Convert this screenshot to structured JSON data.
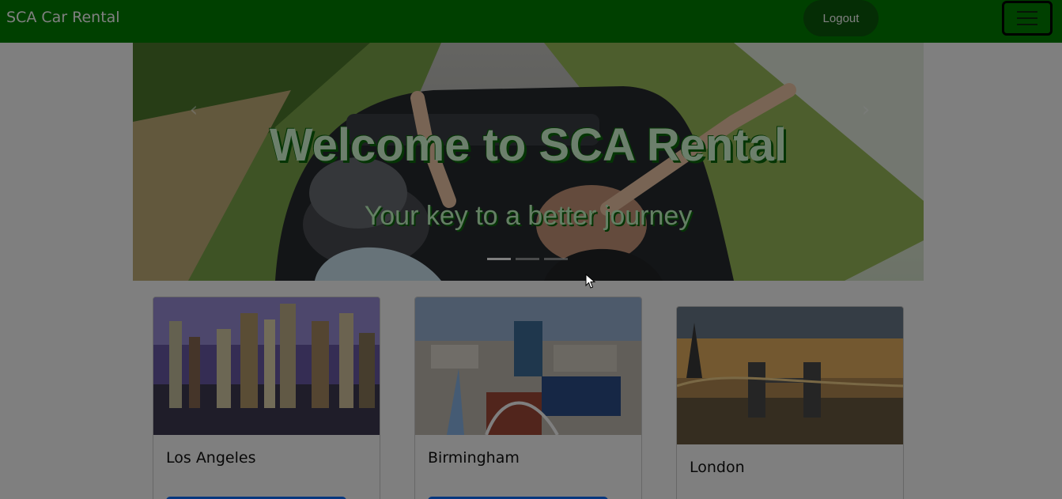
{
  "navbar": {
    "brand": "SCA Car Rental",
    "logout_label": "Logout",
    "menu_icon": "hamburger-icon",
    "color": "#008000"
  },
  "carousel": {
    "title": "Welcome to SCA Rental",
    "subtitle": "Your key to a better journey",
    "slide_count": 3,
    "active_slide": 1
  },
  "cards": [
    {
      "city": "Los Angeles"
    },
    {
      "city": "Birmingham"
    },
    {
      "city": "London"
    }
  ],
  "overlay": {
    "color": "#000000",
    "opacity": 0.5
  },
  "accent_button_color": "#0d6efd"
}
